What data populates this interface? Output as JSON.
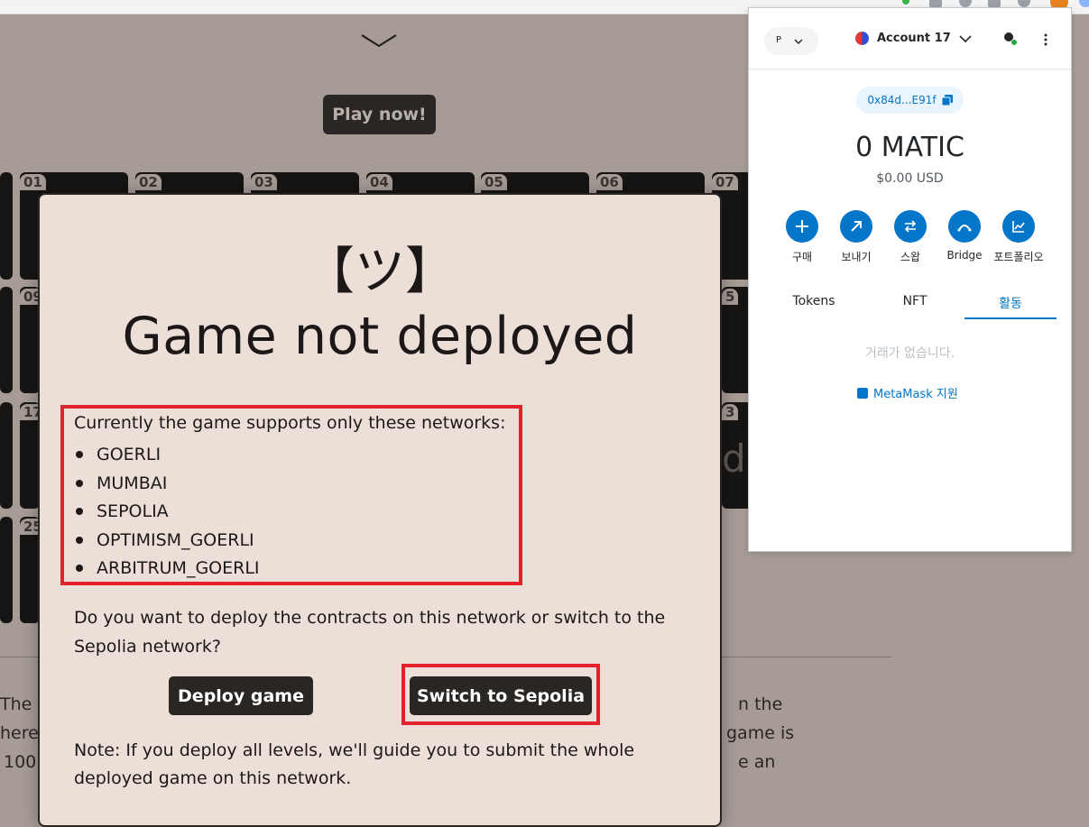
{
  "page": {
    "play_label": "Play now!",
    "tile_numbers": [
      "01",
      "02",
      "03",
      "04",
      "05",
      "06",
      "07"
    ],
    "row_labels": [
      "09",
      "17",
      "25"
    ],
    "right_numbers": [
      "5",
      "3"
    ],
    "background_text": {
      "left": [
        "The",
        "hereu",
        "100"
      ],
      "right": [
        "n the",
        "game is",
        "e an"
      ],
      "partial": "de"
    }
  },
  "modal": {
    "emoji": "【ツ】",
    "title": "Game not deployed",
    "networks_intro": "Currently the game supports only these networks:",
    "networks": [
      "GOERLI",
      "MUMBAI",
      "SEPOLIA",
      "OPTIMISM_GOERLI",
      "ARBITRUM_GOERLI"
    ],
    "question": "Do you want to deploy the contracts on this network or switch to the Sepolia network?",
    "deploy_label": "Deploy game",
    "switch_label": "Switch to Sepolia",
    "note": "Note: If you deploy all levels, we'll guide you to submit the whole deployed game on this network."
  },
  "metamask": {
    "network_initial": "P",
    "account_name": "Account 17",
    "address": "0x84d...E91f",
    "balance": "0 MATIC",
    "usd": "$0.00 USD",
    "actions": [
      {
        "label": "구매",
        "icon": "plus-icon"
      },
      {
        "label": "보내기",
        "icon": "send-arrow-icon"
      },
      {
        "label": "스왑",
        "icon": "swap-icon"
      },
      {
        "label": "Bridge",
        "icon": "bridge-icon"
      },
      {
        "label": "포트폴리오",
        "icon": "portfolio-chart-icon"
      }
    ],
    "tabs": [
      "Tokens",
      "NFT",
      "활동"
    ],
    "active_tab": "활동",
    "empty_text": "거래가 없습니다.",
    "support_text": "MetaMask 지원"
  },
  "colors": {
    "accent_red": "#e3202c",
    "metamask_blue": "#0376c9",
    "modal_bg": "#ecdfd8",
    "dark_button": "#2a2624"
  }
}
